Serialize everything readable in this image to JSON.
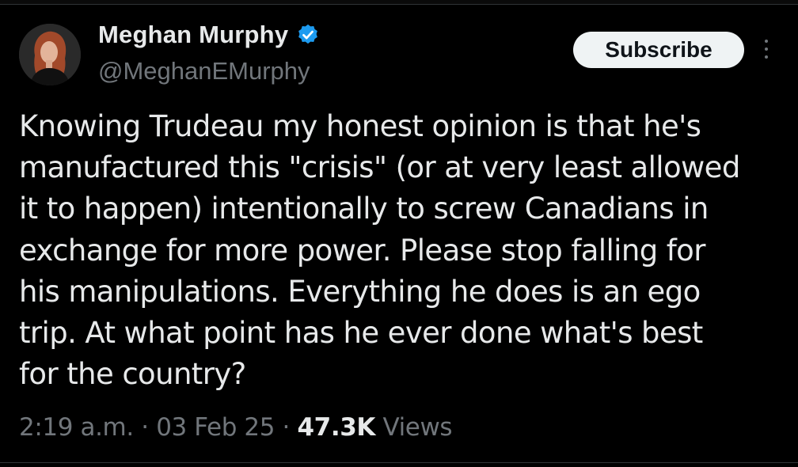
{
  "author": {
    "display_name": "Meghan Murphy",
    "handle": "@MeghanEMurphy",
    "verified": true,
    "avatar_icon": "profile-photo"
  },
  "actions": {
    "subscribe_label": "Subscribe",
    "more_icon": "more-vertical-icon"
  },
  "tweet": {
    "text_lines": [
      "Knowing Trudeau my honest opinion is that he's",
      "manufactured this \"crisis\" (or at very least allowed",
      "it to happen) intentionally to screw Canadians in",
      "exchange for more power. Please stop falling for",
      "his manipulations. Everything he does is an ego",
      "trip. At what point has he ever done what's best",
      "for the country?"
    ]
  },
  "meta": {
    "time": "2:19 a.m.",
    "separator": "·",
    "date": "03 Feb 25",
    "views_count": "47.3K",
    "views_label": "Views"
  },
  "colors": {
    "background": "#000000",
    "text_primary": "#e7e9ea",
    "text_secondary": "#71767b",
    "verified_blue": "#1d9bf0",
    "button_bg": "#eff3f4"
  }
}
